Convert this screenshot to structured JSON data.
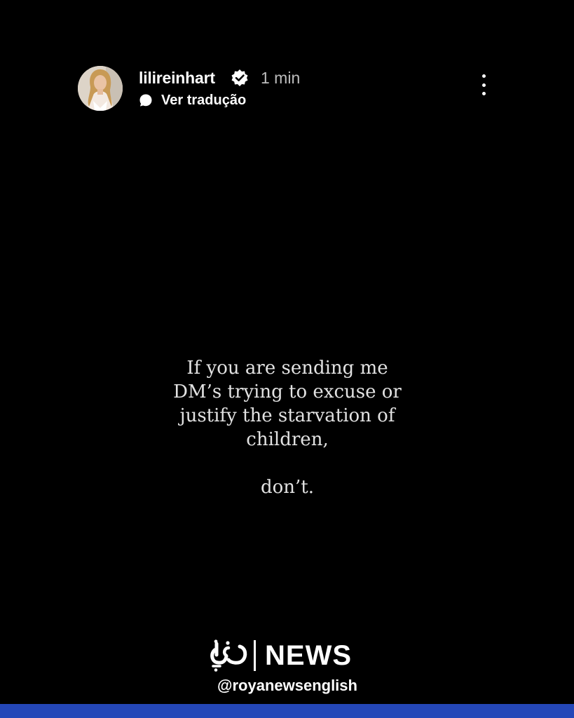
{
  "story_header": {
    "username": "lilireinhart",
    "verified": true,
    "time_ago": "1 min",
    "translate_label": "Ver tradução",
    "avatar_icon": "profile-photo",
    "verified_icon": "verified-badge-icon",
    "translate_icon": "speech-bubble-icon",
    "more_icon": "more-vertical-icon"
  },
  "story_text": {
    "lines": [
      "If you are sending me",
      "DM’s trying to excuse or",
      "justify the starvation of",
      "children,"
    ],
    "closing": "don’t."
  },
  "watermark": {
    "logo_icon": "roya-arabic-logo",
    "brand_name": "NEWS",
    "handle": "@royanewsenglish"
  },
  "colors": {
    "background": "#000000",
    "bottom_bar": "#2447b8",
    "text": "#ffffff",
    "muted_text": "#bdbdbd"
  }
}
